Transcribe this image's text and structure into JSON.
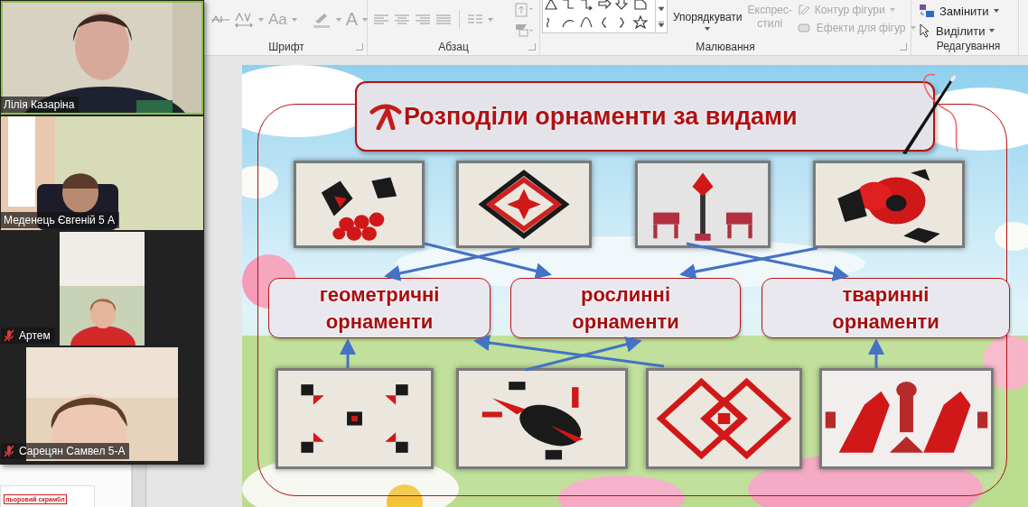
{
  "ribbon": {
    "font": {
      "label": "Шрифт",
      "case_button": {
        "label": "Aa",
        "disabled": true
      },
      "color_button": {
        "label": "A",
        "disabled": true
      }
    },
    "paragraph": {
      "label": "Абзац"
    },
    "drawing": {
      "label": "Малювання",
      "arrange": {
        "label": "Упорядкувати",
        "disabled": false
      },
      "quick_styles": {
        "label": "Експрес-стилі",
        "disabled": true
      },
      "shape_outline": {
        "label": "Контур фігури",
        "disabled": true
      },
      "shape_effects": {
        "label": "Ефекти для фігур",
        "disabled": true
      }
    },
    "editing": {
      "label": "Редагування",
      "replace": {
        "label": "Замінити",
        "disabled": false
      },
      "select": {
        "label": "Виділити",
        "disabled": false
      }
    }
  },
  "thumbnail": {
    "text": "льоровий скрамбл"
  },
  "participants": [
    {
      "name": "Лілія Казаріна",
      "muted": false,
      "speaking": true
    },
    {
      "name": "Меденець Євгеній 5 А",
      "muted": false,
      "speaking": false
    },
    {
      "name": "Артем",
      "muted": true,
      "speaking": false
    },
    {
      "name": "Сарецян Самвел 5-А",
      "muted": true,
      "speaking": false
    }
  ],
  "slide": {
    "title": "Розподіли орнаменти за видами",
    "categories": [
      {
        "label": "геометричні орнаменти"
      },
      {
        "label": "рослинні орнаменти"
      },
      {
        "label": "тваринні орнаменти"
      }
    ]
  }
}
